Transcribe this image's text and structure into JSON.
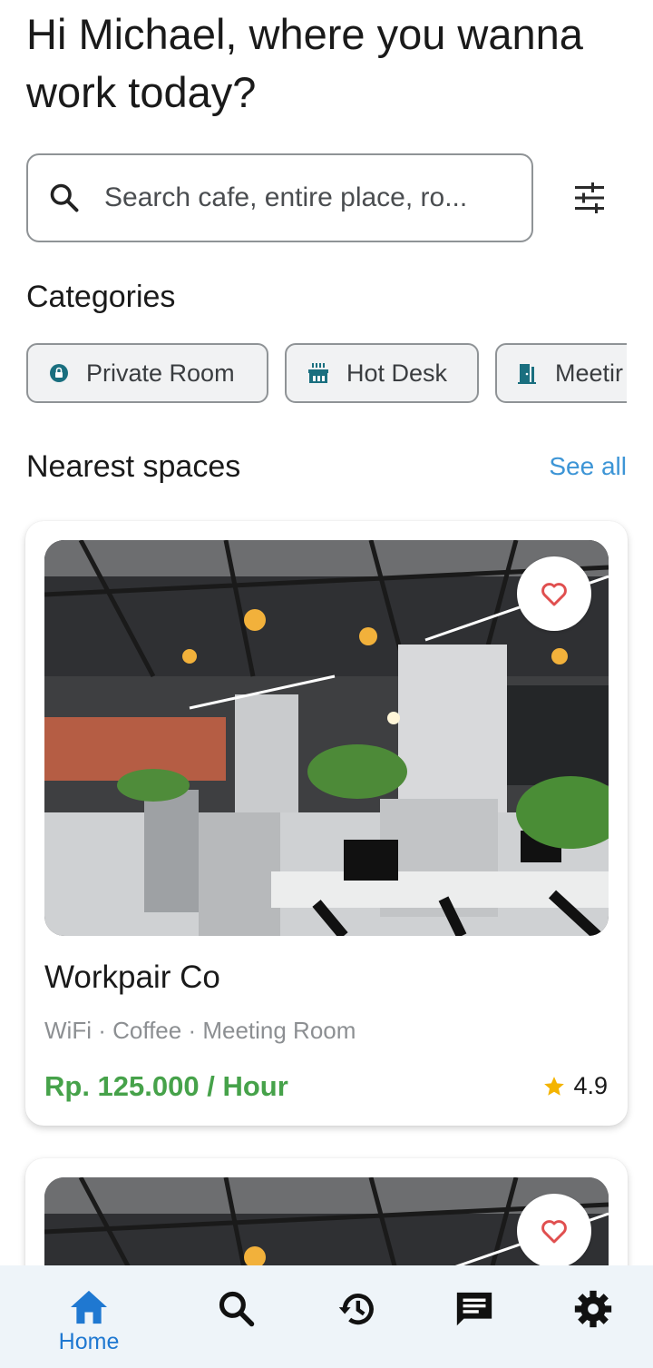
{
  "greeting": "Hi Michael, where you wanna work today?",
  "search": {
    "placeholder": "Search cafe, entire place, ro...",
    "icon": "search-icon"
  },
  "filter_icon": "tune-icon",
  "categories": {
    "title": "Categories",
    "items": [
      {
        "label": "Private Room",
        "icon": "lock-icon"
      },
      {
        "label": "Hot Desk",
        "icon": "desk-icon"
      },
      {
        "label": "Meetir",
        "icon": "door-icon"
      }
    ]
  },
  "nearest": {
    "title": "Nearest spaces",
    "see_all": "See all",
    "cards": [
      {
        "name": "Workpair Co",
        "amenities": "WiFi · Coffee · Meeting Room",
        "price": "Rp. 125.000 / Hour",
        "rating": "4.9",
        "favorite": false
      },
      {
        "name": "",
        "amenities": "",
        "price": "",
        "rating": "",
        "favorite": false
      }
    ]
  },
  "bottom_nav": [
    {
      "label": "Home",
      "icon": "home-icon",
      "active": true
    },
    {
      "label": "",
      "icon": "search-icon",
      "active": false
    },
    {
      "label": "",
      "icon": "history-icon",
      "active": false
    },
    {
      "label": "",
      "icon": "chat-icon",
      "active": false
    },
    {
      "label": "",
      "icon": "settings-icon",
      "active": false
    }
  ],
  "colors": {
    "accent": "#1f78d1",
    "price": "#46a24a",
    "link": "#3d95d6",
    "heart": "#e04f4f",
    "star": "#f4b400",
    "chip_icon": "#1a6f7f"
  }
}
